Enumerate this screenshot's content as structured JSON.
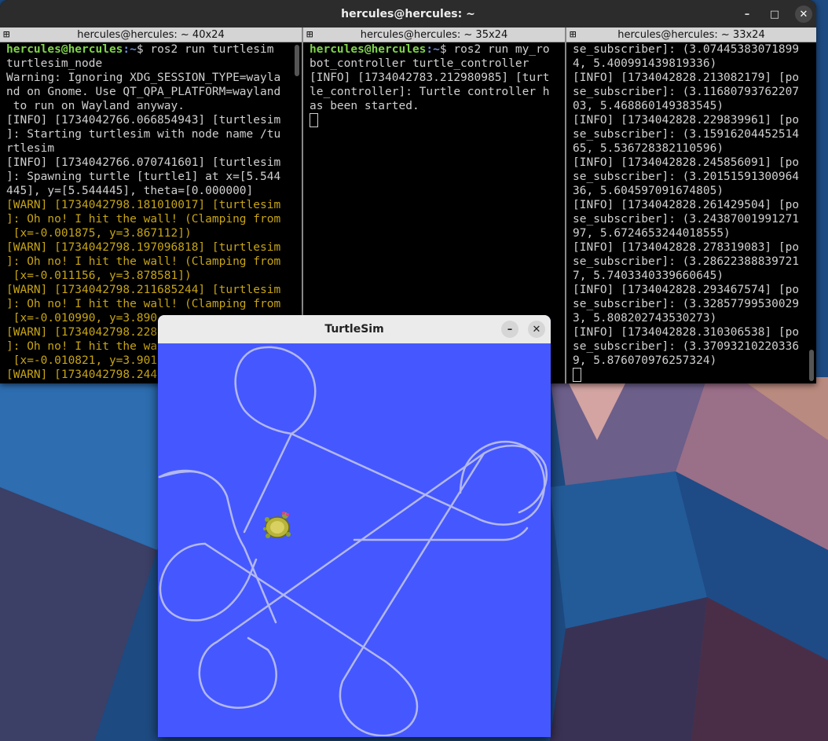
{
  "terminal": {
    "window_title": "hercules@hercules: ~",
    "panes": [
      {
        "tab_title": "hercules@hercules: ~ 40x24",
        "lines": [
          {
            "prompt": "hercules@hercules",
            "path": ":~",
            "text": "$ ros2 run turtlesim"
          },
          {
            "text": "turtlesim_node"
          },
          {
            "text": "Warning: Ignoring XDG_SESSION_TYPE=wayla"
          },
          {
            "text": "nd on Gnome. Use QT_QPA_PLATFORM=wayland"
          },
          {
            "text": " to run on Wayland anyway."
          },
          {
            "text": "[INFO] [1734042766.066854943] [turtlesim"
          },
          {
            "text": "]: Starting turtlesim with node name /tu"
          },
          {
            "text": "rtlesim"
          },
          {
            "text": "[INFO] [1734042766.070741601] [turtlesim"
          },
          {
            "text": "]: Spawning turtle [turtle1] at x=[5.544"
          },
          {
            "text": "445], y=[5.544445], theta=[0.000000]"
          },
          {
            "warn": true,
            "text": "[WARN] [1734042798.181010017] [turtlesim"
          },
          {
            "warn": true,
            "text": "]: Oh no! I hit the wall! (Clamping from"
          },
          {
            "warn": true,
            "text": " [x=-0.001875, y=3.867112])"
          },
          {
            "warn": true,
            "text": "[WARN] [1734042798.197096818] [turtlesim"
          },
          {
            "warn": true,
            "text": "]: Oh no! I hit the wall! (Clamping from"
          },
          {
            "warn": true,
            "text": " [x=-0.011156, y=3.878581])"
          },
          {
            "warn": true,
            "text": "[WARN] [1734042798.211685244] [turtlesim"
          },
          {
            "warn": true,
            "text": "]: Oh no! I hit the wall! (Clamping from"
          },
          {
            "warn": true,
            "text": " [x=-0.010990, y=3.890"
          },
          {
            "warn": true,
            "text": "[WARN] [1734042798.228"
          },
          {
            "warn": true,
            "text": "]: Oh no! I hit the wa"
          },
          {
            "warn": true,
            "text": " [x=-0.010821, y=3.901"
          },
          {
            "warn": true,
            "text": "[WARN] [1734042798.244"
          }
        ]
      },
      {
        "tab_title": "hercules@hercules: ~ 35x24",
        "lines": [
          {
            "prompt": "hercules@hercules",
            "path": ":~",
            "text": "$ ros2 run my_ro"
          },
          {
            "text": "bot_controller turtle_controller"
          },
          {
            "text": "[INFO] [1734042783.212980985] [turt"
          },
          {
            "text": "le_controller]: Turtle controller h"
          },
          {
            "text": "as been started."
          },
          {
            "cursor": true,
            "text": ""
          }
        ]
      },
      {
        "tab_title": "hercules@hercules: ~ 33x24",
        "lines": [
          {
            "text": "se_subscriber]: (3.07445383071899"
          },
          {
            "text": "4, 5.400991439819336)"
          },
          {
            "text": "[INFO] [1734042828.213082179] [po"
          },
          {
            "text": "se_subscriber]: (3.11680793762207"
          },
          {
            "text": "03, 5.468860149383545)"
          },
          {
            "text": "[INFO] [1734042828.229839961] [po"
          },
          {
            "text": "se_subscriber]: (3.15916204452514"
          },
          {
            "text": "65, 5.536728382110596)"
          },
          {
            "text": "[INFO] [1734042828.245856091] [po"
          },
          {
            "text": "se_subscriber]: (3.20151591300964"
          },
          {
            "text": "36, 5.604597091674805)"
          },
          {
            "text": "[INFO] [1734042828.261429504] [po"
          },
          {
            "text": "se_subscriber]: (3.24387001991271"
          },
          {
            "text": "97, 5.6724653244018555)"
          },
          {
            "text": "[INFO] [1734042828.278319083] [po"
          },
          {
            "text": "se_subscriber]: (3.28622388839721"
          },
          {
            "text": "7, 5.7403340339660645)"
          },
          {
            "text": "[INFO] [1734042828.293467574] [po"
          },
          {
            "text": "se_subscriber]: (3.32857799530029"
          },
          {
            "text": "3, 5.808202743530273)"
          },
          {
            "text": "[INFO] [1734042828.310306538] [po"
          },
          {
            "text": "se_subscriber]: (3.37093210220336"
          },
          {
            "text": "9, 5.876070976257324)"
          },
          {
            "cursor": true,
            "text": ""
          }
        ]
      }
    ],
    "controls": {
      "minimize": "–",
      "maximize": "□",
      "close": "✕"
    },
    "tab_icon": "⊞"
  },
  "turtlesim": {
    "window_title": "TurtleSim",
    "controls": {
      "minimize": "–",
      "close": "✕"
    },
    "background_color": "#4558ff",
    "trail_color": "#b3b8f0",
    "turtle": {
      "icon": "turtle-icon"
    }
  },
  "colors": {
    "prompt_user": "#7fd54a",
    "prompt_path": "#6b8fd8",
    "warn_text": "#c7a415",
    "terminal_text": "#d0d0d0"
  }
}
